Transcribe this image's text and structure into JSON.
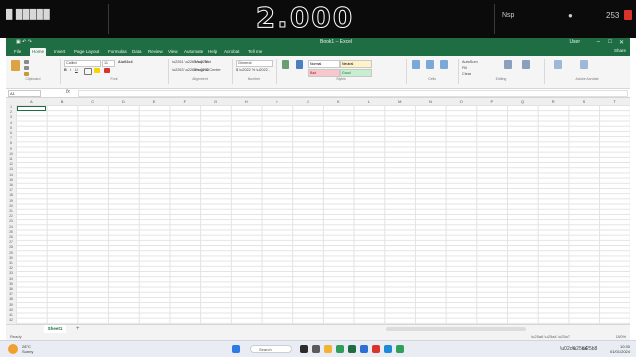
{
  "topbar": {
    "left_label": "█ █████",
    "counter": "2.000",
    "right_a": "Nsp",
    "right_b": "●",
    "right_c": "253",
    "accent_red": "#d9342b"
  },
  "excel": {
    "title": "Book1 – Excel",
    "user": "User",
    "quick_access": "▣ ↶ ↷",
    "window_controls": [
      "–",
      "□",
      "✕"
    ],
    "tabs": [
      "File",
      "Home",
      "Insert",
      "Page Layout",
      "Formulas",
      "Data",
      "Review",
      "View",
      "Automate",
      "Help",
      "Acrobat",
      "Tell me"
    ],
    "share": "Share",
    "ribbon_groups": [
      "Clipboard",
      "Font",
      "Alignment",
      "Number",
      "Styles",
      "Cells",
      "Editing",
      "Adobe Acrobat"
    ],
    "font_name": "Calibri",
    "font_size": "11",
    "number_format": "General",
    "styles": {
      "normal": "Normal",
      "bad": "Bad",
      "good": "Good",
      "neutral": "Neutral"
    },
    "wrap_text": "Wrap Text",
    "merge": "Merge & Center",
    "autosum": "AutoSum",
    "fill": "Fill",
    "clear": "Clear",
    "sort": "Sort & Filter",
    "find": "Find & Select",
    "namebox": "A1",
    "fx": "fx",
    "columns": [
      "A",
      "B",
      "C",
      "D",
      "E",
      "F",
      "G",
      "H",
      "I",
      "J",
      "K",
      "L",
      "M",
      "N",
      "O",
      "P",
      "Q",
      "R",
      "S",
      "T"
    ],
    "rows": [
      "1",
      "2",
      "3",
      "4",
      "5",
      "6",
      "7",
      "8",
      "9",
      "10",
      "11",
      "12",
      "13",
      "14",
      "15",
      "16",
      "17",
      "18",
      "19",
      "20",
      "21",
      "22",
      "23",
      "24",
      "25",
      "26",
      "27",
      "28",
      "29",
      "30",
      "31",
      "32",
      "33",
      "34",
      "35",
      "36",
      "37",
      "38",
      "39",
      "40",
      "41",
      "42"
    ],
    "sheet_tab": "Sheet1",
    "add_sheet": "+",
    "status": "Ready",
    "zoom": "100%",
    "accent": "#1f6e43"
  },
  "taskbar": {
    "weather_temp": "28°C",
    "weather_desc": "Sunny",
    "search": "Search",
    "time": "10:30",
    "date": "01/01/2024"
  }
}
